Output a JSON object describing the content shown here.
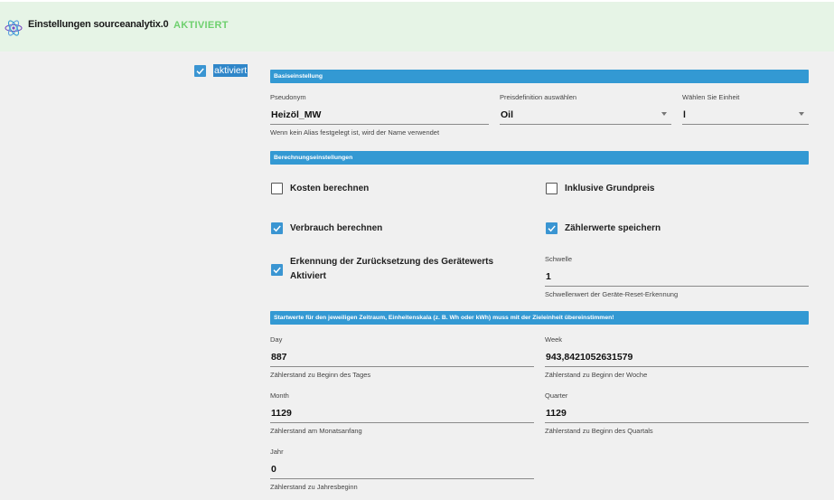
{
  "header": {
    "title": "Einstellungen sourceanalytix.0",
    "status": "AKTIVIERT"
  },
  "activated": {
    "label": "aktiviert",
    "checked": true
  },
  "sections": {
    "basic": "Basiseinstellung",
    "calculation": "Berechnungseinstellungen",
    "start_values": "Startwerte für den jeweiligen Zeitraum, Einheitenskala (z. B. Wh oder kWh) muss mit der Zieleinheit übereinstimmen!"
  },
  "basic": {
    "alias": {
      "label": "Pseudonym",
      "value": "Heizöl_MW",
      "help": "Wenn kein Alias festgelegt ist, wird der Name verwendet"
    },
    "price": {
      "label": "Preisdefinition auswählen",
      "value": "Oil"
    },
    "unit": {
      "label": "Wählen Sie Einheit",
      "value": "l"
    }
  },
  "calc": {
    "costs": {
      "label": "Kosten berechnen",
      "checked": false
    },
    "base_price": {
      "label": "Inklusive Grundpreis",
      "checked": false
    },
    "consumption": {
      "label": "Verbrauch berechnen",
      "checked": true
    },
    "meter_values": {
      "label": "Zählerwerte speichern",
      "checked": true
    },
    "reset_detection": {
      "label_line1": "Erkennung der Zurücksetzung des Gerätewerts",
      "label_line2": "Aktiviert",
      "checked": true
    },
    "threshold": {
      "label": "Schwelle",
      "value": "1",
      "help": "Schwellenwert der Geräte-Reset-Erkennung"
    }
  },
  "start": {
    "day": {
      "label": "Day",
      "value": "887",
      "help": "Zählerstand zu Beginn des Tages"
    },
    "week": {
      "label": "Week",
      "value": "943,8421052631579",
      "help": "Zählerstand zu Beginn der Woche"
    },
    "month": {
      "label": "Month",
      "value": "1129",
      "help": "Zählerstand am Monatsanfang"
    },
    "quarter": {
      "label": "Quarter",
      "value": "1129",
      "help": "Zählerstand zu Beginn des Quartals"
    },
    "year": {
      "label": "Jahr",
      "value": "0",
      "help": "Zählerstand zu Jahresbeginn"
    }
  },
  "colors": {
    "accent": "#3399d3",
    "header_bg": "#e6f4e6",
    "status_green": "#6ed06e"
  },
  "icons": {
    "logo": "atom-logo-icon",
    "check": "check-icon",
    "dropdown": "chevron-down-icon"
  }
}
